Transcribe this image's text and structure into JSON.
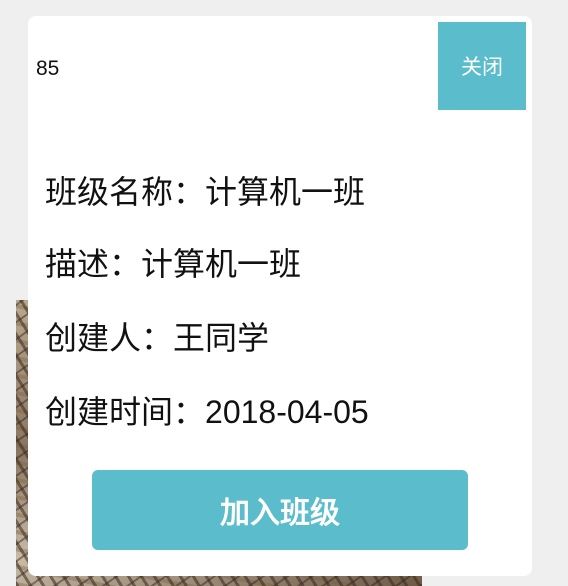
{
  "modal": {
    "id_text": "85",
    "close_label": "关闭",
    "join_label": "加入班级",
    "accent_color": "#5bbccc"
  },
  "info": {
    "class_name": {
      "label": "班级名称：",
      "value": "计算机一班"
    },
    "description": {
      "label": "描述：",
      "value": "计算机一班"
    },
    "creator": {
      "label": "创建人：",
      "value": "王同学"
    },
    "created_time": {
      "label": "创建时间：",
      "value": "2018-04-05"
    }
  }
}
